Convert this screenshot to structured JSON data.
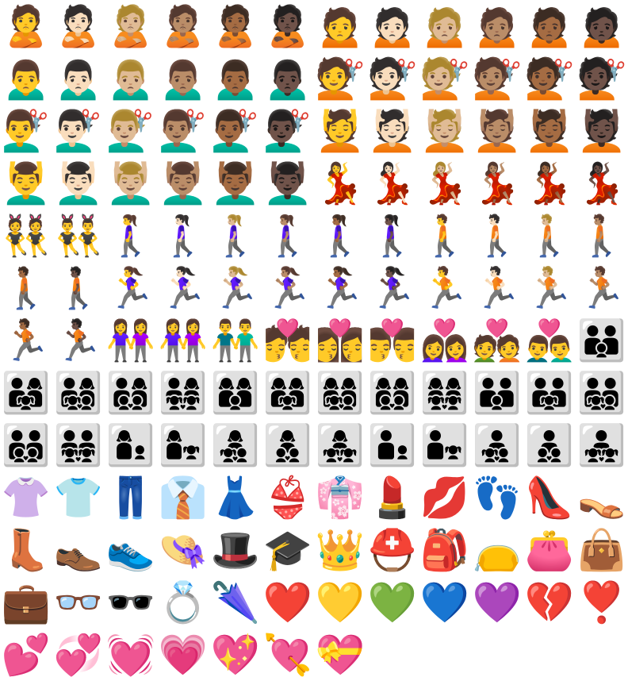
{
  "grid": {
    "columns": 12,
    "rows": [
      {
        "cells": [
          {
            "icon": "person-pouting",
            "glyph": "🙎"
          },
          {
            "icon": "person-pouting-light",
            "glyph": "🙎🏻"
          },
          {
            "icon": "person-pouting-medium-light",
            "glyph": "🙎🏼"
          },
          {
            "icon": "person-pouting-medium",
            "glyph": "🙎🏽"
          },
          {
            "icon": "person-pouting-medium-dark",
            "glyph": "🙎🏾"
          },
          {
            "icon": "person-pouting-dark",
            "glyph": "🙎🏿"
          },
          {
            "icon": "woman-frowning",
            "glyph": "🙍"
          },
          {
            "icon": "woman-frowning-light",
            "glyph": "🙍🏻"
          },
          {
            "icon": "woman-frowning-medium-light",
            "glyph": "🙍🏼"
          },
          {
            "icon": "woman-frowning-medium",
            "glyph": "🙍🏽"
          },
          {
            "icon": "woman-frowning-medium-dark",
            "glyph": "🙍🏾"
          },
          {
            "icon": "woman-frowning-dark",
            "glyph": "🙍🏿"
          }
        ]
      },
      {
        "cells": [
          {
            "icon": "man-frowning",
            "glyph": "🙍‍♂️"
          },
          {
            "icon": "man-frowning-light",
            "glyph": "🙍🏻‍♂️"
          },
          {
            "icon": "man-frowning-medium-light",
            "glyph": "🙍🏼‍♂️"
          },
          {
            "icon": "man-frowning-medium",
            "glyph": "🙍🏽‍♂️"
          },
          {
            "icon": "man-frowning-medium-dark",
            "glyph": "🙍🏾‍♂️"
          },
          {
            "icon": "man-frowning-dark",
            "glyph": "🙍🏿‍♂️"
          },
          {
            "icon": "woman-haircut",
            "glyph": "💇"
          },
          {
            "icon": "woman-haircut-light",
            "glyph": "💇🏻"
          },
          {
            "icon": "woman-haircut-medium-light",
            "glyph": "💇🏼"
          },
          {
            "icon": "woman-haircut-medium",
            "glyph": "💇🏽"
          },
          {
            "icon": "woman-haircut-medium-dark",
            "glyph": "💇🏾"
          },
          {
            "icon": "woman-haircut-dark",
            "glyph": "💇🏿"
          }
        ]
      },
      {
        "cells": [
          {
            "icon": "man-haircut",
            "glyph": "💇‍♂️"
          },
          {
            "icon": "man-haircut-light",
            "glyph": "💇🏻‍♂️"
          },
          {
            "icon": "man-haircut-medium-light",
            "glyph": "💇🏼‍♂️"
          },
          {
            "icon": "man-haircut-medium",
            "glyph": "💇🏽‍♂️"
          },
          {
            "icon": "man-haircut-medium-dark",
            "glyph": "💇🏾‍♂️"
          },
          {
            "icon": "man-haircut-dark",
            "glyph": "💇🏿‍♂️"
          },
          {
            "icon": "woman-massage",
            "glyph": "💆"
          },
          {
            "icon": "woman-massage-light",
            "glyph": "💆🏻"
          },
          {
            "icon": "woman-massage-medium-light",
            "glyph": "💆🏼"
          },
          {
            "icon": "woman-massage-medium",
            "glyph": "💆🏽"
          },
          {
            "icon": "woman-massage-medium-dark",
            "glyph": "💆🏾"
          },
          {
            "icon": "woman-massage-dark",
            "glyph": "💆🏿"
          }
        ]
      },
      {
        "cells": [
          {
            "icon": "man-massage",
            "glyph": "💆‍♂️"
          },
          {
            "icon": "man-massage-light",
            "glyph": "💆🏻‍♂️"
          },
          {
            "icon": "man-massage-medium-light",
            "glyph": "💆🏼‍♂️"
          },
          {
            "icon": "man-massage-medium",
            "glyph": "💆🏽‍♂️"
          },
          {
            "icon": "man-massage-medium-dark",
            "glyph": "💆🏾‍♂️"
          },
          {
            "icon": "man-massage-dark",
            "glyph": "💆🏿‍♂️"
          },
          {
            "icon": "woman-dancing",
            "glyph": "💃"
          },
          {
            "icon": "woman-dancing-light",
            "glyph": "💃🏻"
          },
          {
            "icon": "woman-dancing-medium-light",
            "glyph": "💃🏼"
          },
          {
            "icon": "woman-dancing-medium",
            "glyph": "💃🏽"
          },
          {
            "icon": "woman-dancing-medium-dark",
            "glyph": "💃🏾"
          },
          {
            "icon": "woman-dancing-dark",
            "glyph": "💃🏿"
          }
        ]
      },
      {
        "cells": [
          {
            "icon": "women-with-bunny-ears",
            "glyph": "👯"
          },
          {
            "icon": "men-with-bunny-ears",
            "glyph": "👯‍♂️"
          },
          {
            "icon": "woman-walking",
            "glyph": "🚶‍♀️"
          },
          {
            "icon": "woman-walking-light",
            "glyph": "🚶🏻‍♀️"
          },
          {
            "icon": "woman-walking-medium-light",
            "glyph": "🚶🏼‍♀️"
          },
          {
            "icon": "woman-walking-medium",
            "glyph": "🚶🏽‍♀️"
          },
          {
            "icon": "woman-walking-medium-dark",
            "glyph": "🚶🏾‍♀️"
          },
          {
            "icon": "woman-walking-dark",
            "glyph": "🚶🏿‍♀️"
          },
          {
            "icon": "man-walking",
            "glyph": "🚶"
          },
          {
            "icon": "man-walking-light",
            "glyph": "🚶🏻"
          },
          {
            "icon": "man-walking-medium-light",
            "glyph": "🚶🏼"
          },
          {
            "icon": "man-walking-medium",
            "glyph": "🚶🏽"
          }
        ]
      },
      {
        "cells": [
          {
            "icon": "man-walking-medium-dark",
            "glyph": "🚶🏾"
          },
          {
            "icon": "man-walking-dark",
            "glyph": "🚶🏿"
          },
          {
            "icon": "woman-running",
            "glyph": "🏃‍♀️"
          },
          {
            "icon": "woman-running-light",
            "glyph": "🏃🏻‍♀️"
          },
          {
            "icon": "woman-running-medium-light",
            "glyph": "🏃🏼‍♀️"
          },
          {
            "icon": "woman-running-medium",
            "glyph": "🏃🏽‍♀️"
          },
          {
            "icon": "woman-running-medium-dark",
            "glyph": "🏃🏾‍♀️"
          },
          {
            "icon": "woman-running-dark",
            "glyph": "🏃🏿‍♀️"
          },
          {
            "icon": "man-running",
            "glyph": "🏃"
          },
          {
            "icon": "man-running-light",
            "glyph": "🏃🏻"
          },
          {
            "icon": "man-running-medium-light",
            "glyph": "🏃🏼"
          },
          {
            "icon": "man-running-medium",
            "glyph": "🏃🏽"
          }
        ]
      },
      {
        "cells": [
          {
            "icon": "man-running-medium-dark",
            "glyph": "🏃🏾"
          },
          {
            "icon": "man-running-dark",
            "glyph": "🏃🏿"
          },
          {
            "icon": "two-women-holding-hands",
            "glyph": "👭"
          },
          {
            "icon": "two-women-holding-hands-variant",
            "glyph": "👭"
          },
          {
            "icon": "two-men-holding-hands",
            "glyph": "👬"
          },
          {
            "icon": "kiss-woman-man",
            "glyph": "💏"
          },
          {
            "icon": "kiss-woman-woman",
            "glyph": "👩‍❤️‍💋‍👩"
          },
          {
            "icon": "kiss-man-man",
            "glyph": "👨‍❤️‍💋‍👨"
          },
          {
            "icon": "couple-with-heart-woman-woman",
            "glyph": "👩‍❤️‍👩"
          },
          {
            "icon": "couple-with-heart",
            "glyph": "💑"
          },
          {
            "icon": "couple-with-heart-man-man",
            "glyph": "👨‍❤️‍👨"
          },
          {
            "icon": "family",
            "glyph": "👪"
          }
        ]
      },
      {
        "cells": [
          {
            "icon": "family-man-woman-girl",
            "glyph": "👨‍👩‍👧"
          },
          {
            "icon": "family-man-woman-girl-boy",
            "glyph": "👨‍👩‍👧‍👦"
          },
          {
            "icon": "family-man-woman-boy-boy",
            "glyph": "👨‍👩‍👦‍👦"
          },
          {
            "icon": "family-man-woman-girl-girl",
            "glyph": "👨‍👩‍👧‍👧"
          },
          {
            "icon": "family-woman-woman-boy",
            "glyph": "👩‍👩‍👦"
          },
          {
            "icon": "family-woman-woman-girl",
            "glyph": "👩‍👩‍👧"
          },
          {
            "icon": "family-woman-woman-girl-boy",
            "glyph": "👩‍👩‍👧‍👦"
          },
          {
            "icon": "family-woman-woman-boy-boy",
            "glyph": "👩‍👩‍👦‍👦"
          },
          {
            "icon": "family-woman-woman-girl-girl",
            "glyph": "👩‍👩‍👧‍👧"
          },
          {
            "icon": "family-man-man-boy",
            "glyph": "👨‍👨‍👦"
          },
          {
            "icon": "family-man-man-girl",
            "glyph": "👨‍👨‍👧"
          },
          {
            "icon": "family-man-man-girl-boy",
            "glyph": "👨‍👨‍👧‍👦"
          }
        ]
      },
      {
        "cells": [
          {
            "icon": "family-man-man-boy-boy",
            "glyph": "👨‍👨‍👦‍👦"
          },
          {
            "icon": "family-man-man-girl-girl",
            "glyph": "👨‍👨‍👧‍👧"
          },
          {
            "icon": "family-woman-boy",
            "glyph": "👩‍👦"
          },
          {
            "icon": "family-woman-girl",
            "glyph": "👩‍👧"
          },
          {
            "icon": "family-woman-girl-boy",
            "glyph": "👩‍👧‍👦"
          },
          {
            "icon": "family-woman-boy-boy",
            "glyph": "👩‍👦‍👦"
          },
          {
            "icon": "family-woman-girl-girl",
            "glyph": "👩‍👧‍👧"
          },
          {
            "icon": "family-man-boy",
            "glyph": "👨‍👦"
          },
          {
            "icon": "family-man-girl",
            "glyph": "👨‍👧"
          },
          {
            "icon": "family-man-girl-boy",
            "glyph": "👨‍👧‍👦"
          },
          {
            "icon": "family-man-boy-boy",
            "glyph": "👨‍👦‍👦"
          },
          {
            "icon": "family-man-girl-girl",
            "glyph": "👨‍👧‍👧"
          }
        ]
      },
      {
        "cells": [
          {
            "icon": "womans-clothes",
            "glyph": "👚"
          },
          {
            "icon": "t-shirt",
            "glyph": "👕"
          },
          {
            "icon": "jeans",
            "glyph": "👖"
          },
          {
            "icon": "necktie",
            "glyph": "👔"
          },
          {
            "icon": "dress",
            "glyph": "👗"
          },
          {
            "icon": "bikini",
            "glyph": "👙"
          },
          {
            "icon": "kimono",
            "glyph": "👘"
          },
          {
            "icon": "lipstick",
            "glyph": "💄"
          },
          {
            "icon": "kiss-mark",
            "glyph": "💋"
          },
          {
            "icon": "footprints",
            "glyph": "👣"
          },
          {
            "icon": "high-heeled-shoe",
            "glyph": "👠"
          },
          {
            "icon": "womans-sandal",
            "glyph": "👡"
          }
        ]
      },
      {
        "cells": [
          {
            "icon": "womans-boot",
            "glyph": "👢"
          },
          {
            "icon": "mans-shoe",
            "glyph": "👞"
          },
          {
            "icon": "running-shoe",
            "glyph": "👟"
          },
          {
            "icon": "womans-hat",
            "glyph": "👒"
          },
          {
            "icon": "top-hat",
            "glyph": "🎩"
          },
          {
            "icon": "graduation-cap",
            "glyph": "🎓"
          },
          {
            "icon": "crown",
            "glyph": "👑"
          },
          {
            "icon": "rescue-worker-helmet",
            "glyph": "⛑️"
          },
          {
            "icon": "school-backpack",
            "glyph": "🎒"
          },
          {
            "icon": "clutch-bag",
            "glyph": "👝"
          },
          {
            "icon": "purse",
            "glyph": "👛"
          },
          {
            "icon": "handbag",
            "glyph": "👜"
          }
        ]
      },
      {
        "cells": [
          {
            "icon": "briefcase",
            "glyph": "💼"
          },
          {
            "icon": "glasses",
            "glyph": "👓"
          },
          {
            "icon": "sunglasses",
            "glyph": "🕶️"
          },
          {
            "icon": "ring",
            "glyph": "💍"
          },
          {
            "icon": "closed-umbrella",
            "glyph": "🌂"
          },
          {
            "icon": "red-heart",
            "glyph": "❤️"
          },
          {
            "icon": "yellow-heart",
            "glyph": "💛"
          },
          {
            "icon": "green-heart",
            "glyph": "💚"
          },
          {
            "icon": "blue-heart",
            "glyph": "💙"
          },
          {
            "icon": "purple-heart",
            "glyph": "💜"
          },
          {
            "icon": "broken-heart",
            "glyph": "💔"
          },
          {
            "icon": "heart-exclamation",
            "glyph": "❣️"
          }
        ]
      },
      {
        "cells": [
          {
            "icon": "two-hearts",
            "glyph": "💕"
          },
          {
            "icon": "revolving-hearts",
            "glyph": "💞"
          },
          {
            "icon": "beating-heart",
            "glyph": "💓"
          },
          {
            "icon": "growing-heart",
            "glyph": "💗"
          },
          {
            "icon": "sparkling-heart",
            "glyph": "💖"
          },
          {
            "icon": "heart-with-arrow",
            "glyph": "💘"
          },
          {
            "icon": "heart-with-ribbon",
            "glyph": "💝"
          }
        ]
      }
    ]
  }
}
